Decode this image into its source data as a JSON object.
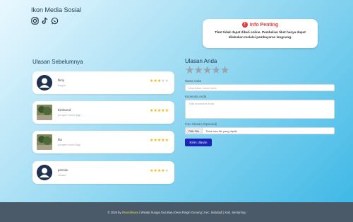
{
  "social": {
    "title": "Ikon Media Sosial",
    "icons": [
      "instagram-icon",
      "tiktok-icon",
      "whatsapp-icon"
    ]
  },
  "info": {
    "title": "Info Penting",
    "text": "Tiket tidak dapat dibeli online. Pembelian tiket hanya dapat dilakukan melalui pembayaran langsung."
  },
  "reviews": {
    "heading": "Ulasan Sebelumnya",
    "items": [
      {
        "name": "fikriy",
        "comment": "bagus",
        "rating": 3,
        "avatar": "default"
      },
      {
        "name": "bimbumd",
        "comment": "pengen kesini lagi ....",
        "rating": 5,
        "avatar": "photo"
      },
      {
        "name": "fita",
        "comment": "pengen kesini lagi",
        "rating": 5,
        "avatar": "photo"
      },
      {
        "name": "pemidu",
        "comment": "wisata",
        "rating": 4,
        "avatar": "default"
      }
    ]
  },
  "form": {
    "title": "Ulasan Anda",
    "stars_count": 5,
    "name_label": "Nama Anda",
    "name_placeholder": "Masukkan nama Anda",
    "comment_label": "Komentar Anda",
    "comment_placeholder": "Tulis komentar Anda",
    "photo_label": "Foto Ulasan (Opsional)",
    "file_button": "Pilih File",
    "file_status": "Tidak ada file yang dipilih",
    "submit_label": "Kirim Ulasan"
  },
  "footer": {
    "prefix": "© 2025 by",
    "brand": "ilmusoftware",
    "rest": "| Wisata Sungai Gua Baru Desa Ringin Gunung | Kec. Sidodadi | Kab. Sentanrng"
  },
  "colors": {
    "accent": "#1a24b5",
    "star": "#f0b40e",
    "info": "#e23b3b",
    "footer": "#4b5a68"
  }
}
